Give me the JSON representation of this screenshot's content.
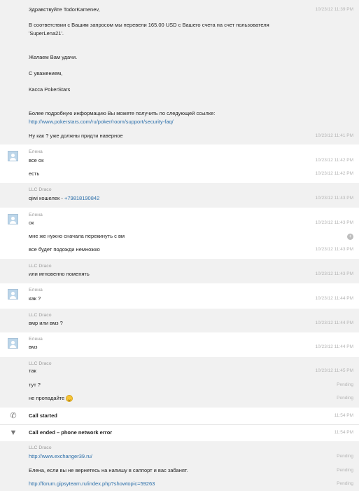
{
  "intro": {
    "greeting": "Здравствуйте TodorKamenev,",
    "greeting_time": "10/23/12 11:39 PM",
    "para1_line1": "В соответствии с Вашим запросом мы перевели 165.00 USD с Вашего счета на счет пользователя",
    "para1_line2": "'SuperLena21'.",
    "wish": "Желаем Вам удачи.",
    "regards": "С уважением,",
    "signature": "Касса PokerStars",
    "more_info": "Более подробную информацию Вы можете получить по следующей ссылке:",
    "link": "http://www.pokerstars.com/ru/poker/room/support/security-faq/",
    "followup": "Ну как ? уже должны придти наверное",
    "followup_time": "10/23/12 11:41 PM"
  },
  "blocks": [
    {
      "sender": "Елена",
      "messages": [
        {
          "text": "все ок",
          "time": "10/23/12 11:42 PM"
        },
        {
          "text": "есть",
          "time": "10/23/12 11:42 PM"
        }
      ]
    },
    {
      "sender": "LLC Draco",
      "messages": [
        {
          "text": "qiwi кошелек - ",
          "link": "+79818190842",
          "time": "10/23/12 11:43 PM"
        }
      ]
    },
    {
      "sender": "Елена",
      "messages": [
        {
          "text": "ок",
          "time": "10/23/12 11:43 PM"
        },
        {
          "text": "мне же нужно сначала перекинуть с вм"
        },
        {
          "text": "все будет подожди немножко",
          "time": "10/23/12 11:43 PM"
        }
      ]
    },
    {
      "sender": "LLC Draco",
      "messages": [
        {
          "text": "или мгновенно поменять",
          "time": "10/23/12 11:43 PM"
        }
      ]
    },
    {
      "sender": "Елена",
      "messages": [
        {
          "text": "как ?",
          "time": "10/23/12 11:44 PM"
        }
      ]
    },
    {
      "sender": "LLC Draco",
      "messages": [
        {
          "text": "вмр или вмз ?",
          "time": "10/23/12 11:44 PM"
        }
      ]
    },
    {
      "sender": "Елена",
      "messages": [
        {
          "text": "вмз",
          "time": "10/23/12 11:44 PM"
        }
      ]
    },
    {
      "sender": "LLC Draco",
      "messages": [
        {
          "text": "так",
          "time": "10/23/12 11:45 PM"
        },
        {
          "text": "тут ?",
          "time": "Pending"
        },
        {
          "text": "не пропадайте",
          "time": "Pending"
        }
      ]
    },
    {
      "sender": "LLC Draco",
      "messages": [
        {
          "link": "http://www.exchanger39.ru/",
          "time": "Pending"
        },
        {
          "text": "Елена, если вы не вернетесь на напишу в саппорт и вас забанят.",
          "time": "Pending"
        },
        {
          "link": "http://forum.gipsyteam.ru/index.php?showtopic=59263",
          "time": "Pending"
        }
      ]
    }
  ],
  "system": {
    "call_started": "Call started",
    "call_started_time": "11:54 PM",
    "call_ended": "Call ended – phone network error",
    "call_ended_time": "11:54 PM"
  },
  "colors": {
    "link": "#2a6ea9",
    "gray_block": "#f1f1f1",
    "time": "#b5b5b5"
  },
  "icons": [
    "avatar-icon",
    "call-icon",
    "call-ended-icon",
    "smiley-icon",
    "more-icon"
  ]
}
